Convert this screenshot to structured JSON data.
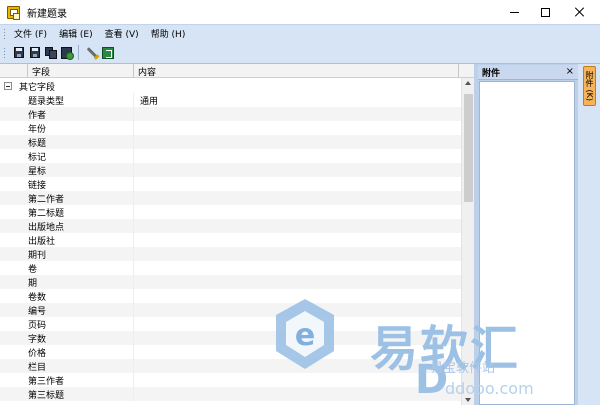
{
  "window": {
    "title": "新建题录"
  },
  "menu": {
    "items": [
      {
        "label": "文件 (F)"
      },
      {
        "label": "编辑 (E)"
      },
      {
        "label": "查看 (V)"
      },
      {
        "label": "帮助 (H)"
      }
    ]
  },
  "toolbar": {
    "icons": [
      "save-icon",
      "save-as-icon",
      "save-copy-icon",
      "save-close-icon",
      "edit-icon",
      "exit-icon"
    ]
  },
  "grid": {
    "columns": {
      "field": "字段",
      "content": "内容"
    },
    "group": {
      "label": "其它字段",
      "expander": "⊟"
    },
    "rows": [
      {
        "field": "题录类型",
        "value": "通用"
      },
      {
        "field": "作者",
        "value": ""
      },
      {
        "field": "年份",
        "value": ""
      },
      {
        "field": "标题",
        "value": ""
      },
      {
        "field": "标记",
        "value": ""
      },
      {
        "field": "星标",
        "value": ""
      },
      {
        "field": "链接",
        "value": ""
      },
      {
        "field": "第二作者",
        "value": ""
      },
      {
        "field": "第二标题",
        "value": ""
      },
      {
        "field": "出版地点",
        "value": ""
      },
      {
        "field": "出版社",
        "value": ""
      },
      {
        "field": "期刊",
        "value": ""
      },
      {
        "field": "卷",
        "value": ""
      },
      {
        "field": "期",
        "value": ""
      },
      {
        "field": "卷数",
        "value": ""
      },
      {
        "field": "编号",
        "value": ""
      },
      {
        "field": "页码",
        "value": ""
      },
      {
        "field": "字数",
        "value": ""
      },
      {
        "field": "价格",
        "value": ""
      },
      {
        "field": "栏目",
        "value": ""
      },
      {
        "field": "第三作者",
        "value": ""
      },
      {
        "field": "第三标题",
        "value": ""
      }
    ]
  },
  "attachments": {
    "title": "附件",
    "close": "×"
  },
  "side_tab": {
    "label": "附件 (K)"
  },
  "watermark": {
    "brand": "易软汇",
    "subtitle": "易宝软件站",
    "url": "ddooo.com"
  },
  "colors": {
    "chrome": "#d6e4f5",
    "panel": "#bcd0ea",
    "side_tab": "#f7b35a",
    "watermark": "#9cc1e5"
  }
}
